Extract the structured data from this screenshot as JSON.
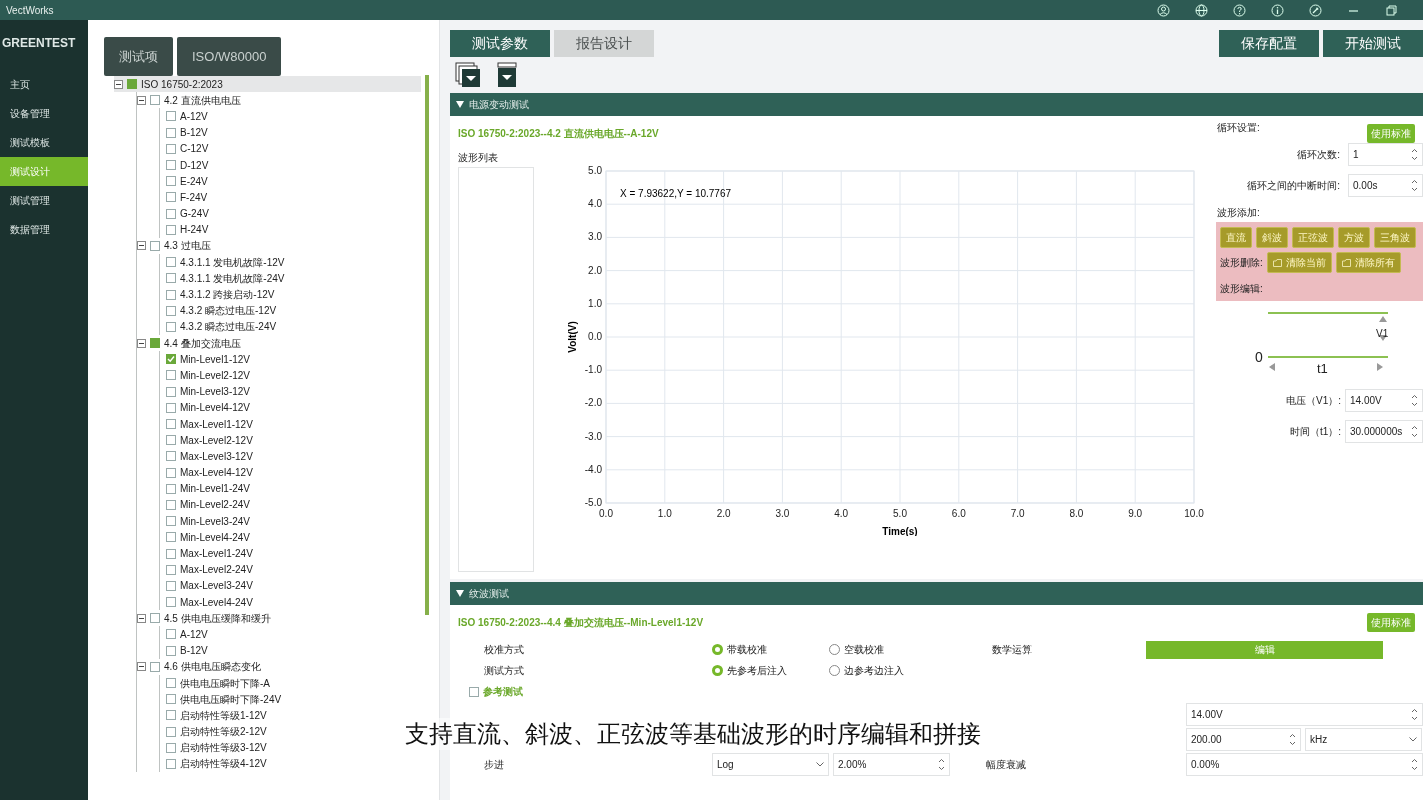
{
  "window": {
    "title": "VectWorks"
  },
  "logo": "GREENTEST",
  "sidebar": {
    "items": [
      {
        "label": "主页",
        "selected": false
      },
      {
        "label": "设备管理",
        "selected": false
      },
      {
        "label": "测试模板",
        "selected": false
      },
      {
        "label": "测试设计",
        "selected": true
      },
      {
        "label": "测试管理",
        "selected": false
      },
      {
        "label": "数据管理",
        "selected": false
      }
    ]
  },
  "tree_tabs": [
    {
      "label": "测试项"
    },
    {
      "label": "ISO/W80000"
    }
  ],
  "tree": [
    {
      "label": "ISO 16750-2:2023",
      "checked": false,
      "partial": true,
      "expanded": true,
      "selected": true,
      "children": [
        {
          "label": "4.2 直流供电电压",
          "checked": false,
          "partial": false,
          "expanded": true,
          "selected": false,
          "children": [
            {
              "label": "A-12V",
              "checked": false,
              "selected": false
            },
            {
              "label": "B-12V",
              "checked": false,
              "selected": false
            },
            {
              "label": "C-12V",
              "checked": false,
              "selected": false
            },
            {
              "label": "D-12V",
              "checked": false,
              "selected": false
            },
            {
              "label": "E-24V",
              "checked": false,
              "selected": false
            },
            {
              "label": "F-24V",
              "checked": false,
              "selected": false
            },
            {
              "label": "G-24V",
              "checked": false,
              "selected": false
            },
            {
              "label": "H-24V",
              "checked": false,
              "selected": false
            }
          ]
        },
        {
          "label": "4.3 过电压",
          "checked": false,
          "partial": false,
          "expanded": true,
          "selected": false,
          "children": [
            {
              "label": "4.3.1.1 发电机故障-12V",
              "checked": false,
              "selected": false
            },
            {
              "label": "4.3.1.1 发电机故障-24V",
              "checked": false,
              "selected": false
            },
            {
              "label": "4.3.1.2 跨接启动-12V",
              "checked": false,
              "selected": false
            },
            {
              "label": "4.3.2 瞬态过电压-12V",
              "checked": false,
              "selected": false
            },
            {
              "label": "4.3.2 瞬态过电压-24V",
              "checked": false,
              "selected": false
            }
          ]
        },
        {
          "label": "4.4 叠加交流电压",
          "checked": false,
          "partial": true,
          "expanded": true,
          "selected": false,
          "children": [
            {
              "label": "Min-Level1-12V",
              "checked": true,
              "selected": false
            },
            {
              "label": "Min-Level2-12V",
              "checked": false,
              "selected": false
            },
            {
              "label": "Min-Level3-12V",
              "checked": false,
              "selected": false
            },
            {
              "label": "Min-Level4-12V",
              "checked": false,
              "selected": false
            },
            {
              "label": "Max-Level1-12V",
              "checked": false,
              "selected": false
            },
            {
              "label": "Max-Level2-12V",
              "checked": false,
              "selected": false
            },
            {
              "label": "Max-Level3-12V",
              "checked": false,
              "selected": false
            },
            {
              "label": "Max-Level4-12V",
              "checked": false,
              "selected": false
            },
            {
              "label": "Min-Level1-24V",
              "checked": false,
              "selected": false
            },
            {
              "label": "Min-Level2-24V",
              "checked": false,
              "selected": false
            },
            {
              "label": "Min-Level3-24V",
              "checked": false,
              "selected": false
            },
            {
              "label": "Min-Level4-24V",
              "checked": false,
              "selected": false
            },
            {
              "label": "Max-Level1-24V",
              "checked": false,
              "selected": false
            },
            {
              "label": "Max-Level2-24V",
              "checked": false,
              "selected": false
            },
            {
              "label": "Max-Level3-24V",
              "checked": false,
              "selected": false
            },
            {
              "label": "Max-Level4-24V",
              "checked": false,
              "selected": false
            }
          ]
        },
        {
          "label": "4.5 供电电压缓降和缓升",
          "checked": false,
          "partial": false,
          "expanded": true,
          "selected": false,
          "children": [
            {
              "label": "A-12V",
              "checked": false,
              "selected": false
            },
            {
              "label": "B-12V",
              "checked": false,
              "selected": false
            }
          ]
        },
        {
          "label": "4.6 供电电压瞬态变化",
          "checked": false,
          "partial": false,
          "expanded": true,
          "selected": false,
          "children": [
            {
              "label": "供电电压瞬时下降-A",
              "checked": false,
              "selected": false
            },
            {
              "label": "供电电压瞬时下降-24V",
              "checked": false,
              "selected": false
            },
            {
              "label": "启动特性等级1-12V",
              "checked": false,
              "selected": false
            },
            {
              "label": "启动特性等级2-12V",
              "checked": false,
              "selected": false
            },
            {
              "label": "启动特性等级3-12V",
              "checked": false,
              "selected": false
            },
            {
              "label": "启动特性等级4-12V",
              "checked": false,
              "selected": false
            }
          ]
        }
      ]
    }
  ],
  "tabs": [
    {
      "label": "测试参数",
      "selected": true
    },
    {
      "label": "报告设计",
      "selected": false
    }
  ],
  "actions": [
    "保存配置",
    "开始测试"
  ],
  "power_section": {
    "header": "电源变动测试",
    "expanded": true,
    "title": "ISO 16750-2:2023--4.2 直流供电电压--A-12V",
    "standard_button": "使用标准",
    "list_label": "波形列表",
    "chart": {
      "readout": "X = 7.93622,Y = 10.7767",
      "chart_data": {
        "type": "line",
        "grid": true,
        "xlabel": "Time(s)",
        "ylabel": "Volt(V)",
        "xlim": [
          0,
          10
        ],
        "ylim": [
          -5,
          5
        ],
        "xticks": [
          {
            "value": 0,
            "label": "0.0"
          },
          {
            "value": 1,
            "label": "1.0"
          },
          {
            "value": 2,
            "label": "2.0"
          },
          {
            "value": 3,
            "label": "3.0"
          },
          {
            "value": 4,
            "label": "4.0"
          },
          {
            "value": 5,
            "label": "5.0"
          },
          {
            "value": 6,
            "label": "6.0"
          },
          {
            "value": 7,
            "label": "7.0"
          },
          {
            "value": 8,
            "label": "8.0"
          },
          {
            "value": 9,
            "label": "9.0"
          },
          {
            "value": 10,
            "label": "10.0"
          }
        ],
        "yticks": [
          {
            "value": 5,
            "label": "5.0"
          },
          {
            "value": 4,
            "label": "4.0"
          },
          {
            "value": 3,
            "label": "3.0"
          },
          {
            "value": 2,
            "label": "2.0"
          },
          {
            "value": 1,
            "label": "1.0"
          },
          {
            "value": 0,
            "label": "0.0"
          },
          {
            "value": -1,
            "label": "-1.0"
          },
          {
            "value": -2,
            "label": "-2.0"
          },
          {
            "value": -3,
            "label": "-3.0"
          },
          {
            "value": -4,
            "label": "-4.0"
          },
          {
            "value": -5,
            "label": "-5.0"
          }
        ]
      }
    },
    "loop_heading": "循环设置:",
    "loop_fields": [
      {
        "label": "循环次数:",
        "value": "1"
      },
      {
        "label": "循环之间的中断时间:",
        "value": "0.00s"
      }
    ],
    "add_label": "波形添加:",
    "wave_buttons": [
      "直流",
      "斜波",
      "正弦波",
      "方波",
      "三角波"
    ],
    "delete_label": "波形删除:",
    "delete_buttons": [
      "清除当前",
      "清除所有"
    ],
    "edit_label": "波形编辑:",
    "diagram": {
      "v_label": "V1",
      "zero": "0",
      "t_label": "t1"
    },
    "params": [
      {
        "label": "电压（V1）:",
        "value": "14.00V"
      },
      {
        "label": "时间（t1）:",
        "value": "30.000000s"
      }
    ]
  },
  "ripple_section": {
    "header": "纹波测试",
    "expanded": true,
    "title": "ISO 16750-2:2023--4.4 叠加交流电压--Min-Level1-12V",
    "standard_button": "使用标准",
    "radio_rows": [
      {
        "label": "校准方式",
        "options": [
          {
            "label": "带载校准",
            "selected": true
          },
          {
            "label": "空载校准",
            "selected": false
          }
        ]
      },
      {
        "label": "测试方式",
        "options": [
          {
            "label": "先参考后注入",
            "selected": true
          },
          {
            "label": "边参考边注入",
            "selected": false
          }
        ]
      }
    ],
    "math": {
      "label": "数学运算",
      "button": "编辑"
    },
    "reference": {
      "label": "参考测试",
      "checked": false
    },
    "voltage": {
      "value": "14.00V"
    },
    "frequency": {
      "value": "200.00",
      "unit": "kHz"
    },
    "step": {
      "label": "步进",
      "mode": "Log",
      "value": "2.00%"
    },
    "attenuation": {
      "label": "幅度衰减",
      "value": "0.00%"
    }
  },
  "caption": "支持直流、斜波、正弦波等基础波形的时序编辑和拼接"
}
